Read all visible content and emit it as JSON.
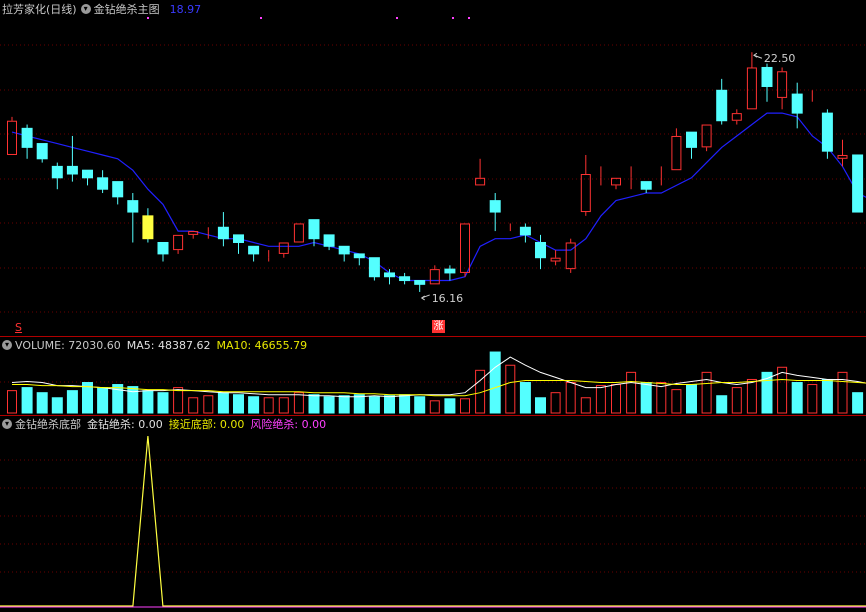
{
  "main": {
    "stock_name": "拉芳家化(日线)",
    "indicator_name": "金钻绝杀主图",
    "price_value": "18.97",
    "high_label": "22.50",
    "low_label": "16.16",
    "limit_up_marker": "涨",
    "signal_marker": "S"
  },
  "volume": {
    "label": "VOLUME: 72030.60",
    "ma5": "MA5: 48387.62",
    "ma10": "MA10: 46655.79"
  },
  "bottom": {
    "name": "金钻绝杀底部",
    "jz": "金钻绝杀: 0.00",
    "jjdb": "接近底部: 0.00",
    "fxjs": "风险绝杀: 0.00"
  },
  "colors": {
    "up": "#ff3232",
    "down": "#54ffff",
    "ma": "#2020ff",
    "vol_ma5": "#ffffff",
    "vol_ma10": "#ffff00",
    "signal": "#ffff40",
    "risk": "#ff40ff",
    "separator": "#b00000"
  },
  "chart_data": {
    "type": "candlestick",
    "price_range": [
      15.3,
      23.5
    ],
    "candles": [
      [
        19.9,
        20.8,
        20.9,
        19.9
      ],
      [
        20.6,
        20.1,
        20.7,
        19.8
      ],
      [
        20.2,
        19.8,
        20.2,
        19.7
      ],
      [
        19.6,
        19.3,
        19.7,
        19.0
      ],
      [
        19.6,
        19.4,
        20.4,
        19.2
      ],
      [
        19.5,
        19.3,
        19.5,
        19.1
      ],
      [
        19.3,
        19.0,
        19.5,
        18.9
      ],
      [
        19.2,
        18.8,
        19.2,
        18.6
      ],
      [
        18.7,
        18.4,
        18.9,
        17.6
      ],
      [
        18.3,
        17.7,
        18.5,
        17.6
      ],
      [
        17.6,
        17.3,
        17.6,
        17.1
      ],
      [
        17.4,
        17.8,
        17.8,
        17.3
      ],
      [
        17.8,
        17.9,
        17.9,
        17.7
      ],
      [
        17.9,
        17.9,
        18.0,
        17.7
      ],
      [
        18.0,
        17.7,
        18.4,
        17.5
      ],
      [
        17.8,
        17.6,
        17.8,
        17.3
      ],
      [
        17.5,
        17.3,
        17.5,
        17.1
      ],
      [
        17.2,
        17.2,
        17.4,
        17.1
      ],
      [
        17.3,
        17.6,
        17.6,
        17.2
      ],
      [
        17.6,
        18.1,
        18.1,
        17.6
      ],
      [
        18.2,
        17.7,
        18.2,
        17.5
      ],
      [
        17.8,
        17.5,
        17.8,
        17.4
      ],
      [
        17.5,
        17.3,
        17.5,
        17.1
      ],
      [
        17.3,
        17.2,
        17.3,
        17.0
      ],
      [
        17.2,
        16.7,
        17.2,
        16.6
      ],
      [
        16.8,
        16.7,
        16.9,
        16.5
      ],
      [
        16.7,
        16.6,
        16.8,
        16.5
      ],
      [
        16.6,
        16.5,
        16.6,
        16.3
      ],
      [
        16.5,
        16.9,
        17.0,
        16.5
      ],
      [
        16.9,
        16.8,
        17.0,
        16.6
      ],
      [
        16.8,
        18.1,
        18.1,
        16.7
      ],
      [
        19.1,
        19.3,
        19.8,
        19.1
      ],
      [
        18.7,
        18.4,
        18.9,
        17.9
      ],
      [
        18.1,
        18.1,
        18.1,
        17.9
      ],
      [
        18.0,
        17.8,
        18.1,
        17.6
      ],
      [
        17.6,
        17.2,
        17.8,
        16.9
      ],
      [
        17.1,
        17.2,
        17.4,
        17.0
      ],
      [
        16.9,
        17.6,
        17.7,
        16.8
      ],
      [
        18.4,
        19.4,
        19.9,
        18.3
      ],
      [
        19.3,
        19.3,
        19.6,
        19.1
      ],
      [
        19.1,
        19.3,
        19.3,
        19.0
      ],
      [
        19.3,
        19.3,
        19.6,
        19.0
      ],
      [
        19.2,
        19.0,
        19.2,
        18.9
      ],
      [
        19.1,
        19.1,
        19.6,
        19.1
      ],
      [
        19.5,
        20.4,
        20.6,
        19.5
      ],
      [
        20.5,
        20.1,
        20.5,
        19.8
      ],
      [
        20.1,
        20.7,
        20.7,
        20.0
      ],
      [
        21.6,
        20.8,
        21.9,
        20.7
      ],
      [
        20.8,
        21.0,
        21.1,
        20.7
      ],
      [
        21.1,
        22.2,
        22.6,
        21.1
      ],
      [
        22.2,
        21.7,
        22.3,
        21.3
      ],
      [
        21.4,
        22.1,
        22.2,
        21.1
      ],
      [
        21.5,
        21.0,
        21.8,
        20.6
      ],
      [
        21.6,
        21.6,
        21.6,
        21.3
      ],
      [
        21.0,
        20.0,
        21.1,
        19.8
      ],
      [
        19.8,
        19.9,
        20.3,
        19.6
      ],
      [
        19.9,
        18.4,
        19.9,
        18.4
      ],
      [
        18.6,
        18.8,
        19.5,
        18.4
      ],
      [
        19.1,
        19.4,
        19.6,
        18.9
      ],
      [
        19.4,
        19.3,
        19.5,
        19.0
      ],
      [
        19.7,
        19.6,
        20.1,
        19.4
      ],
      [
        19.7,
        20.4,
        20.4,
        19.5
      ]
    ],
    "ma": [
      20.5,
      20.4,
      20.3,
      20.2,
      20.1,
      20.0,
      19.9,
      19.8,
      19.5,
      19.0,
      18.6,
      17.9,
      17.9,
      17.8,
      17.7,
      17.7,
      17.6,
      17.5,
      17.5,
      17.5,
      17.6,
      17.5,
      17.4,
      17.3,
      17.1,
      16.8,
      16.6,
      16.6,
      16.6,
      16.6,
      16.7,
      17.5,
      17.7,
      17.7,
      17.8,
      17.6,
      17.4,
      17.4,
      17.7,
      18.3,
      18.7,
      18.8,
      18.9,
      18.9,
      19.1,
      19.3,
      19.7,
      20.1,
      20.4,
      20.7,
      21.0,
      21.0,
      20.9,
      20.4,
      20.1,
      19.6,
      18.9,
      18.7,
      18.8,
      18.9,
      19.1,
      19.4
    ],
    "volume": [
      22,
      25,
      20,
      15,
      22,
      30,
      25,
      28,
      26,
      22,
      20,
      25,
      15,
      17,
      20,
      18,
      16,
      15,
      15,
      20,
      18,
      16,
      17,
      18,
      16,
      17,
      18,
      16,
      12,
      14,
      14,
      42,
      60,
      47,
      30,
      15,
      20,
      30,
      15,
      27,
      28,
      40,
      30,
      30,
      23,
      28,
      40,
      17,
      25,
      33,
      40,
      45,
      30,
      28,
      33,
      40,
      20,
      15,
      17,
      20,
      24,
      30
    ],
    "vol_ma5": [
      30,
      31,
      30,
      27,
      27,
      26,
      25,
      23,
      21,
      22,
      22,
      23,
      22,
      21,
      20,
      20,
      19,
      18,
      18,
      18,
      17,
      17,
      16,
      16,
      17,
      16,
      17,
      18,
      18,
      18,
      20,
      32,
      45,
      55,
      47,
      40,
      35,
      30,
      25,
      25,
      28,
      30,
      28,
      26,
      29,
      31,
      33,
      30,
      28,
      30,
      34,
      40,
      37,
      35,
      33,
      33,
      31,
      28,
      26,
      24,
      22,
      24
    ],
    "vol_ma10": [
      28,
      28,
      27,
      27,
      26,
      26,
      25,
      25,
      24,
      23,
      23,
      22,
      22,
      22,
      21,
      21,
      21,
      21,
      21,
      21,
      20,
      20,
      20,
      19,
      19,
      18,
      18,
      18,
      17,
      17,
      17,
      20,
      25,
      30,
      32,
      32,
      32,
      32,
      31,
      30,
      30,
      31,
      30,
      29,
      28,
      28,
      29,
      30,
      30,
      31,
      32,
      33,
      32,
      32,
      32,
      31,
      30,
      29,
      28,
      27,
      26,
      25
    ],
    "signal": {
      "index": 9,
      "value": 1
    }
  }
}
